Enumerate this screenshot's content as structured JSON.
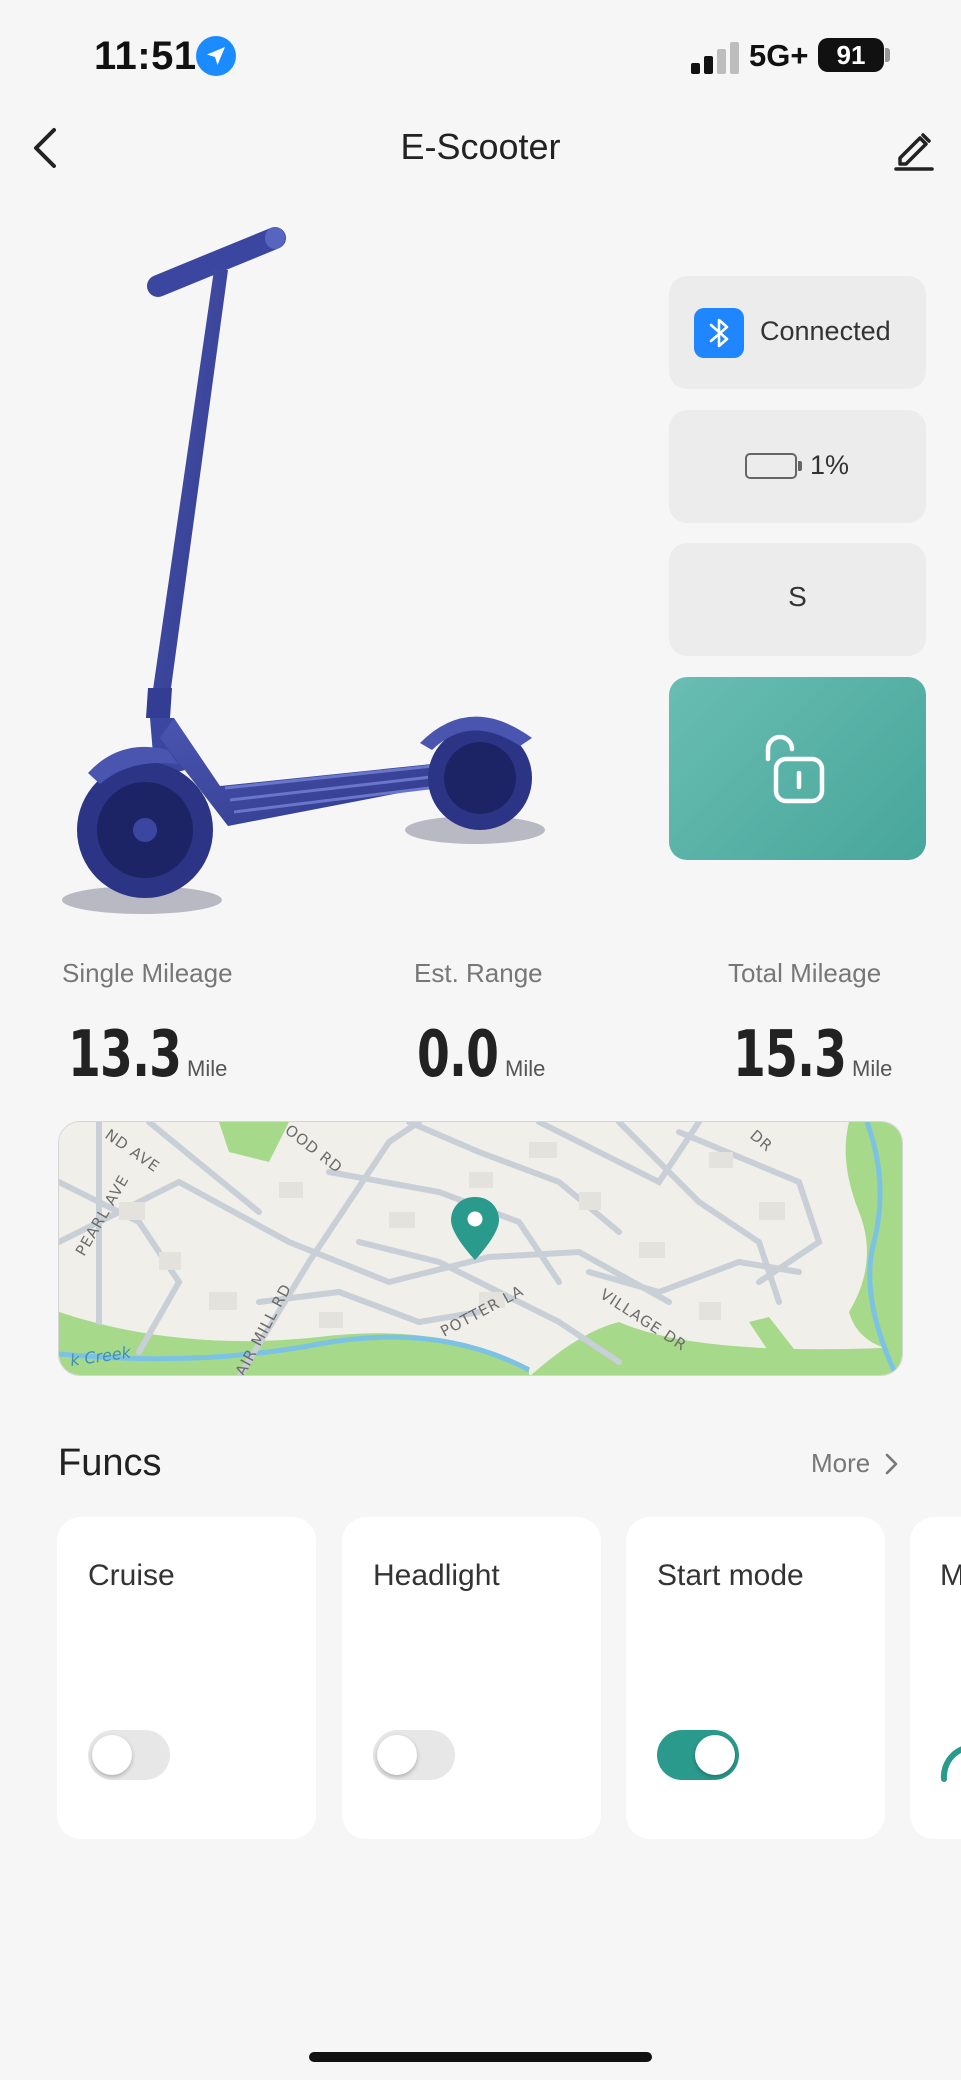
{
  "status_bar": {
    "time": "11:51",
    "network": "5G+",
    "battery_level": "91"
  },
  "header": {
    "title": "E-Scooter"
  },
  "device": {
    "connection": "Connected",
    "battery": "1%",
    "battery_fraction": 0.01,
    "mode": "S",
    "lock_state": "unlocked"
  },
  "stats": [
    {
      "label": "Single Mileage",
      "value": "13.3",
      "unit": "Mile"
    },
    {
      "label": "Est. Range",
      "value": "0.0",
      "unit": "Mile"
    },
    {
      "label": "Total Mileage",
      "value": "15.3",
      "unit": "Mile"
    }
  ],
  "map": {
    "streets": [
      "ND AVE",
      "PEARL AVE",
      "OOD RD",
      "AIR MILL RD",
      "POTTER LA",
      "VILLAGE DR",
      "DR",
      "k Creek"
    ]
  },
  "funcs": {
    "title": "Funcs",
    "more": "More",
    "items": [
      {
        "label": "Cruise",
        "on": false
      },
      {
        "label": "Headlight",
        "on": false
      },
      {
        "label": "Start mode",
        "on": true
      }
    ],
    "partial_label": "M"
  },
  "colors": {
    "accent": "#2a9a8c",
    "lock_button": "#55ada1",
    "bluetooth": "#1f86ff",
    "scooter": "#3b46a0",
    "location": "#1a8cff"
  }
}
